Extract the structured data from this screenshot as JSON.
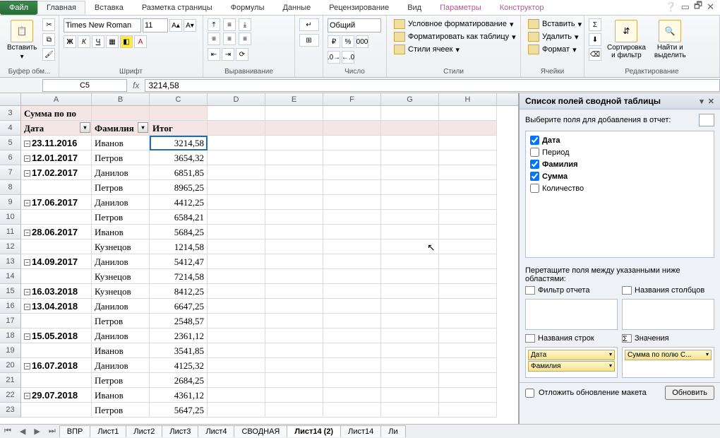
{
  "tabs": {
    "file": "Файл",
    "items": [
      "Главная",
      "Вставка",
      "Разметка страницы",
      "Формулы",
      "Данные",
      "Рецензирование",
      "Вид",
      "Параметры",
      "Конструктор"
    ],
    "active_index": 0
  },
  "ribbon": {
    "clipboard": {
      "label": "Буфер обм...",
      "paste": "Вставить"
    },
    "font": {
      "label": "Шрифт",
      "name": "Times New Roman",
      "size": "11"
    },
    "alignment": {
      "label": "Выравнивание"
    },
    "number": {
      "label": "Число",
      "format": "Общий"
    },
    "styles": {
      "label": "Стили",
      "cond": "Условное форматирование",
      "table": "Форматировать как таблицу",
      "cell": "Стили ячеек"
    },
    "cells": {
      "label": "Ячейки",
      "insert": "Вставить",
      "delete": "Удалить",
      "format": "Формат"
    },
    "editing": {
      "label": "Редактирование",
      "sort": "Сортировка\nи фильтр",
      "find": "Найти и\nвыделить"
    }
  },
  "formula_bar": {
    "name": "C5",
    "value": "3214,58"
  },
  "columns": [
    "A",
    "B",
    "C",
    "D",
    "E",
    "F",
    "G",
    "H"
  ],
  "pivot_headers": {
    "sum_label": "Сумма по по",
    "date": "Дата",
    "surname": "Фамилия",
    "total": "Итог"
  },
  "rows": [
    {
      "n": 3,
      "A": "_SUMLABEL_"
    },
    {
      "n": 4,
      "A": "_HDR_"
    },
    {
      "n": 5,
      "date": "23.11.2016",
      "name": "Иванов",
      "val": "3214,58",
      "selected": true
    },
    {
      "n": 6,
      "date": "12.01.2017",
      "name": "Петров",
      "val": "3654,32"
    },
    {
      "n": 7,
      "date": "17.02.2017",
      "name": "Данилов",
      "val": "6851,85"
    },
    {
      "n": 8,
      "name": "Петров",
      "val": "8965,25"
    },
    {
      "n": 9,
      "date": "17.06.2017",
      "name": "Данилов",
      "val": "4412,25"
    },
    {
      "n": 10,
      "name": "Петров",
      "val": "6584,21"
    },
    {
      "n": 11,
      "date": "28.06.2017",
      "name": "Иванов",
      "val": "5684,25"
    },
    {
      "n": 12,
      "name": "Кузнецов",
      "val": "1214,58"
    },
    {
      "n": 13,
      "date": "14.09.2017",
      "name": "Данилов",
      "val": "5412,47"
    },
    {
      "n": 14,
      "name": "Кузнецов",
      "val": "7214,58"
    },
    {
      "n": 15,
      "date": "16.03.2018",
      "name": "Кузнецов",
      "val": "8412,25"
    },
    {
      "n": 16,
      "date": "13.04.2018",
      "name": "Данилов",
      "val": "6647,25"
    },
    {
      "n": 17,
      "name": "Петров",
      "val": "2548,57"
    },
    {
      "n": 18,
      "date": "15.05.2018",
      "name": "Данилов",
      "val": "2361,12"
    },
    {
      "n": 19,
      "name": "Иванов",
      "val": "3541,85"
    },
    {
      "n": 20,
      "date": "16.07.2018",
      "name": "Данилов",
      "val": "4125,32"
    },
    {
      "n": 21,
      "name": "Петров",
      "val": "2684,25"
    },
    {
      "n": 22,
      "date": "29.07.2018",
      "name": "Иванов",
      "val": "4361,12"
    },
    {
      "n": 23,
      "name": "Петров",
      "val": "5647,25"
    }
  ],
  "pivot_pane": {
    "title": "Список полей сводной таблицы",
    "choose": "Выберите поля для добавления в отчет:",
    "fields": [
      {
        "label": "Дата",
        "checked": true
      },
      {
        "label": "Период",
        "checked": false
      },
      {
        "label": "Фамилия",
        "checked": true
      },
      {
        "label": "Сумма",
        "checked": true
      },
      {
        "label": "Количество",
        "checked": false
      }
    ],
    "drag": "Перетащите поля между указанными ниже областями:",
    "zone_filter": "Фильтр отчета",
    "zone_cols": "Названия столбцов",
    "zone_rows": "Названия строк",
    "zone_vals": "Значения",
    "row_chips": [
      "Дата",
      "Фамилия"
    ],
    "val_chips": [
      "Сумма по полю С..."
    ],
    "defer": "Отложить обновление макета",
    "update": "Обновить"
  },
  "sheet_tabs": {
    "items": [
      "ВПР",
      "Лист1",
      "Лист2",
      "Лист3",
      "Лист4",
      "СВОДНАЯ",
      "Лист14 (2)",
      "Лист14",
      "Ли"
    ],
    "active_index": 6
  }
}
